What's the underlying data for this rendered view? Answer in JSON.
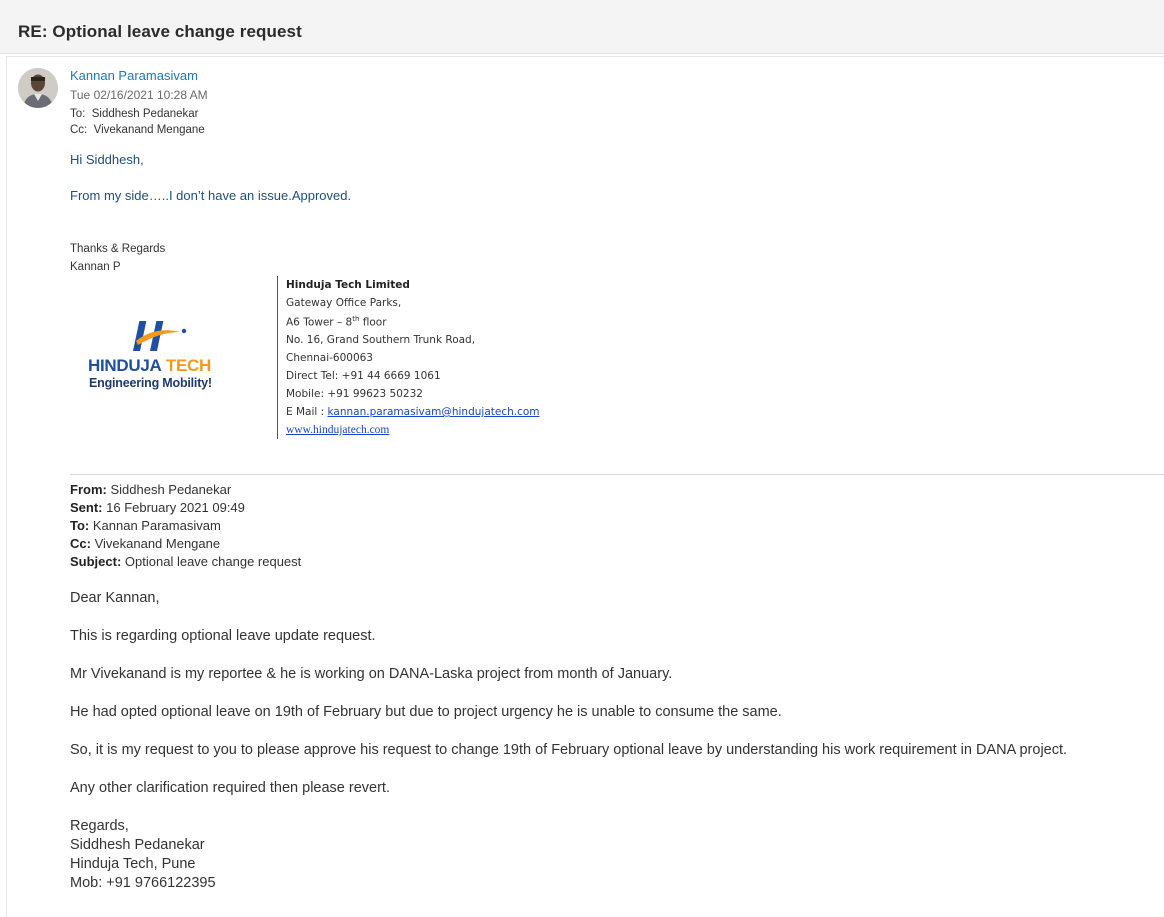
{
  "subject": "RE: Optional leave change request",
  "message": {
    "sender_name": "Kannan Paramasivam",
    "sent_time": "Tue 02/16/2021 10:28 AM",
    "to_label": "To:",
    "to": "Siddhesh Pedanekar",
    "cc_label": "Cc:",
    "cc": "Vivekanand Mengane",
    "greeting": "Hi Siddhesh,",
    "body": "From my side…..I don’t have an issue.Approved.",
    "signoff": "Thanks & Regards",
    "signature_name": "Kannan P"
  },
  "logo": {
    "text_main": "HINDUJA",
    "text_accent": "TECH",
    "tagline": "Engineering Mobility!",
    "colors": {
      "blue": "#1f4fa0",
      "orange": "#f39a1d"
    }
  },
  "signature": {
    "company": "Hinduja Tech Limited",
    "address1": "Gateway Office Parks,",
    "address2_pre": "A6 Tower – 8",
    "address2_sup": "th",
    "address2_post": " floor",
    "address3": "No. 16, Grand Southern Trunk Road,",
    "address4": "Chennai-600063",
    "direct": "Direct  Tel: +91 44 6669 1061",
    "mobile": "Mobile: +91  99623 50232",
    "email_label": "E Mail : ",
    "email": "kannan.paramasivam@hindujatech.com",
    "website": "www.hindujatech.com"
  },
  "quoted": {
    "from_label": "From:",
    "from": "Siddhesh Pedanekar",
    "sent_label": "Sent:",
    "sent": "16 February 2021 09:49",
    "to_label": "To:",
    "to": "Kannan Paramasivam",
    "cc_label": "Cc:",
    "cc": "Vivekanand Mengane",
    "subject_label": "Subject:",
    "subject": "Optional leave change request",
    "lines": [
      "Dear Kannan,",
      "This is regarding optional leave update request.",
      "Mr Vivekanand is my reportee & he is working on DANA-Laska project from month of January.",
      "He had opted optional leave on 19th of February but due to project urgency he is unable to consume the same.",
      "So, it is my request to you to please approve his request to change 19th of February optional leave by understanding his work requirement in DANA project.",
      "Any other clarification required then please revert."
    ],
    "regards": "Regards,",
    "name": "Siddhesh Pedanekar",
    "org": "Hinduja Tech, Pune",
    "mobile": "Mob: +91 9766122395"
  },
  "colors": {
    "sender_link": "#2276b5",
    "reply_text": "#1f4e79",
    "hyperlink": "#1a44c7"
  }
}
